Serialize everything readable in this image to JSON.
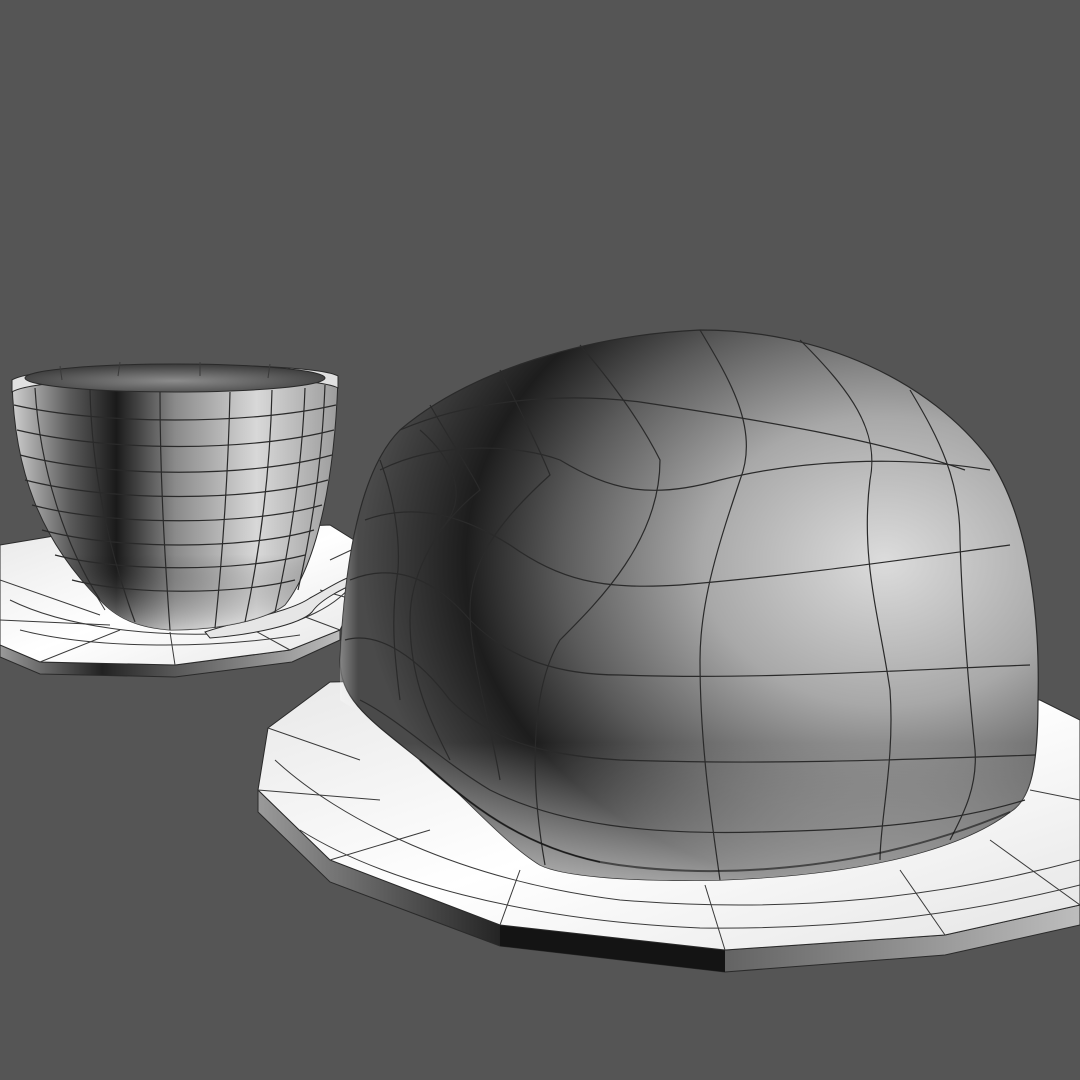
{
  "scene": {
    "background_color": "#555555",
    "objects": [
      {
        "name": "teacup-with-saucer",
        "display": "wireframe-shaded"
      },
      {
        "name": "inverted-cup-dome-on-saucer",
        "display": "wireframe-shaded"
      }
    ],
    "colors": {
      "surface_light": "#f4f4f4",
      "surface_shadow": "#151515",
      "wire": "#2a2a2a",
      "rim_dark": "#1c1c1c"
    }
  }
}
